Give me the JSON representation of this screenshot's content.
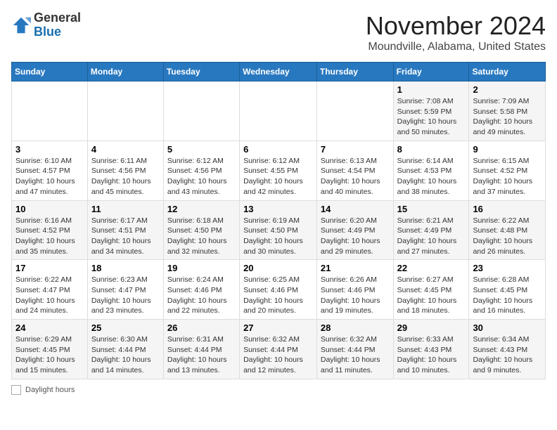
{
  "logo": {
    "general": "General",
    "blue": "Blue"
  },
  "header": {
    "month": "November 2024",
    "location": "Moundville, Alabama, United States"
  },
  "weekdays": [
    "Sunday",
    "Monday",
    "Tuesday",
    "Wednesday",
    "Thursday",
    "Friday",
    "Saturday"
  ],
  "weeks": [
    [
      {
        "day": "",
        "info": ""
      },
      {
        "day": "",
        "info": ""
      },
      {
        "day": "",
        "info": ""
      },
      {
        "day": "",
        "info": ""
      },
      {
        "day": "",
        "info": ""
      },
      {
        "day": "1",
        "info": "Sunrise: 7:08 AM\nSunset: 5:59 PM\nDaylight: 10 hours\nand 50 minutes."
      },
      {
        "day": "2",
        "info": "Sunrise: 7:09 AM\nSunset: 5:58 PM\nDaylight: 10 hours\nand 49 minutes."
      }
    ],
    [
      {
        "day": "3",
        "info": "Sunrise: 6:10 AM\nSunset: 4:57 PM\nDaylight: 10 hours\nand 47 minutes."
      },
      {
        "day": "4",
        "info": "Sunrise: 6:11 AM\nSunset: 4:56 PM\nDaylight: 10 hours\nand 45 minutes."
      },
      {
        "day": "5",
        "info": "Sunrise: 6:12 AM\nSunset: 4:56 PM\nDaylight: 10 hours\nand 43 minutes."
      },
      {
        "day": "6",
        "info": "Sunrise: 6:12 AM\nSunset: 4:55 PM\nDaylight: 10 hours\nand 42 minutes."
      },
      {
        "day": "7",
        "info": "Sunrise: 6:13 AM\nSunset: 4:54 PM\nDaylight: 10 hours\nand 40 minutes."
      },
      {
        "day": "8",
        "info": "Sunrise: 6:14 AM\nSunset: 4:53 PM\nDaylight: 10 hours\nand 38 minutes."
      },
      {
        "day": "9",
        "info": "Sunrise: 6:15 AM\nSunset: 4:52 PM\nDaylight: 10 hours\nand 37 minutes."
      }
    ],
    [
      {
        "day": "10",
        "info": "Sunrise: 6:16 AM\nSunset: 4:52 PM\nDaylight: 10 hours\nand 35 minutes."
      },
      {
        "day": "11",
        "info": "Sunrise: 6:17 AM\nSunset: 4:51 PM\nDaylight: 10 hours\nand 34 minutes."
      },
      {
        "day": "12",
        "info": "Sunrise: 6:18 AM\nSunset: 4:50 PM\nDaylight: 10 hours\nand 32 minutes."
      },
      {
        "day": "13",
        "info": "Sunrise: 6:19 AM\nSunset: 4:50 PM\nDaylight: 10 hours\nand 30 minutes."
      },
      {
        "day": "14",
        "info": "Sunrise: 6:20 AM\nSunset: 4:49 PM\nDaylight: 10 hours\nand 29 minutes."
      },
      {
        "day": "15",
        "info": "Sunrise: 6:21 AM\nSunset: 4:49 PM\nDaylight: 10 hours\nand 27 minutes."
      },
      {
        "day": "16",
        "info": "Sunrise: 6:22 AM\nSunset: 4:48 PM\nDaylight: 10 hours\nand 26 minutes."
      }
    ],
    [
      {
        "day": "17",
        "info": "Sunrise: 6:22 AM\nSunset: 4:47 PM\nDaylight: 10 hours\nand 24 minutes."
      },
      {
        "day": "18",
        "info": "Sunrise: 6:23 AM\nSunset: 4:47 PM\nDaylight: 10 hours\nand 23 minutes."
      },
      {
        "day": "19",
        "info": "Sunrise: 6:24 AM\nSunset: 4:46 PM\nDaylight: 10 hours\nand 22 minutes."
      },
      {
        "day": "20",
        "info": "Sunrise: 6:25 AM\nSunset: 4:46 PM\nDaylight: 10 hours\nand 20 minutes."
      },
      {
        "day": "21",
        "info": "Sunrise: 6:26 AM\nSunset: 4:46 PM\nDaylight: 10 hours\nand 19 minutes."
      },
      {
        "day": "22",
        "info": "Sunrise: 6:27 AM\nSunset: 4:45 PM\nDaylight: 10 hours\nand 18 minutes."
      },
      {
        "day": "23",
        "info": "Sunrise: 6:28 AM\nSunset: 4:45 PM\nDaylight: 10 hours\nand 16 minutes."
      }
    ],
    [
      {
        "day": "24",
        "info": "Sunrise: 6:29 AM\nSunset: 4:45 PM\nDaylight: 10 hours\nand 15 minutes."
      },
      {
        "day": "25",
        "info": "Sunrise: 6:30 AM\nSunset: 4:44 PM\nDaylight: 10 hours\nand 14 minutes."
      },
      {
        "day": "26",
        "info": "Sunrise: 6:31 AM\nSunset: 4:44 PM\nDaylight: 10 hours\nand 13 minutes."
      },
      {
        "day": "27",
        "info": "Sunrise: 6:32 AM\nSunset: 4:44 PM\nDaylight: 10 hours\nand 12 minutes."
      },
      {
        "day": "28",
        "info": "Sunrise: 6:32 AM\nSunset: 4:44 PM\nDaylight: 10 hours\nand 11 minutes."
      },
      {
        "day": "29",
        "info": "Sunrise: 6:33 AM\nSunset: 4:43 PM\nDaylight: 10 hours\nand 10 minutes."
      },
      {
        "day": "30",
        "info": "Sunrise: 6:34 AM\nSunset: 4:43 PM\nDaylight: 10 hours\nand 9 minutes."
      }
    ]
  ],
  "legend": {
    "label": "Daylight hours"
  }
}
